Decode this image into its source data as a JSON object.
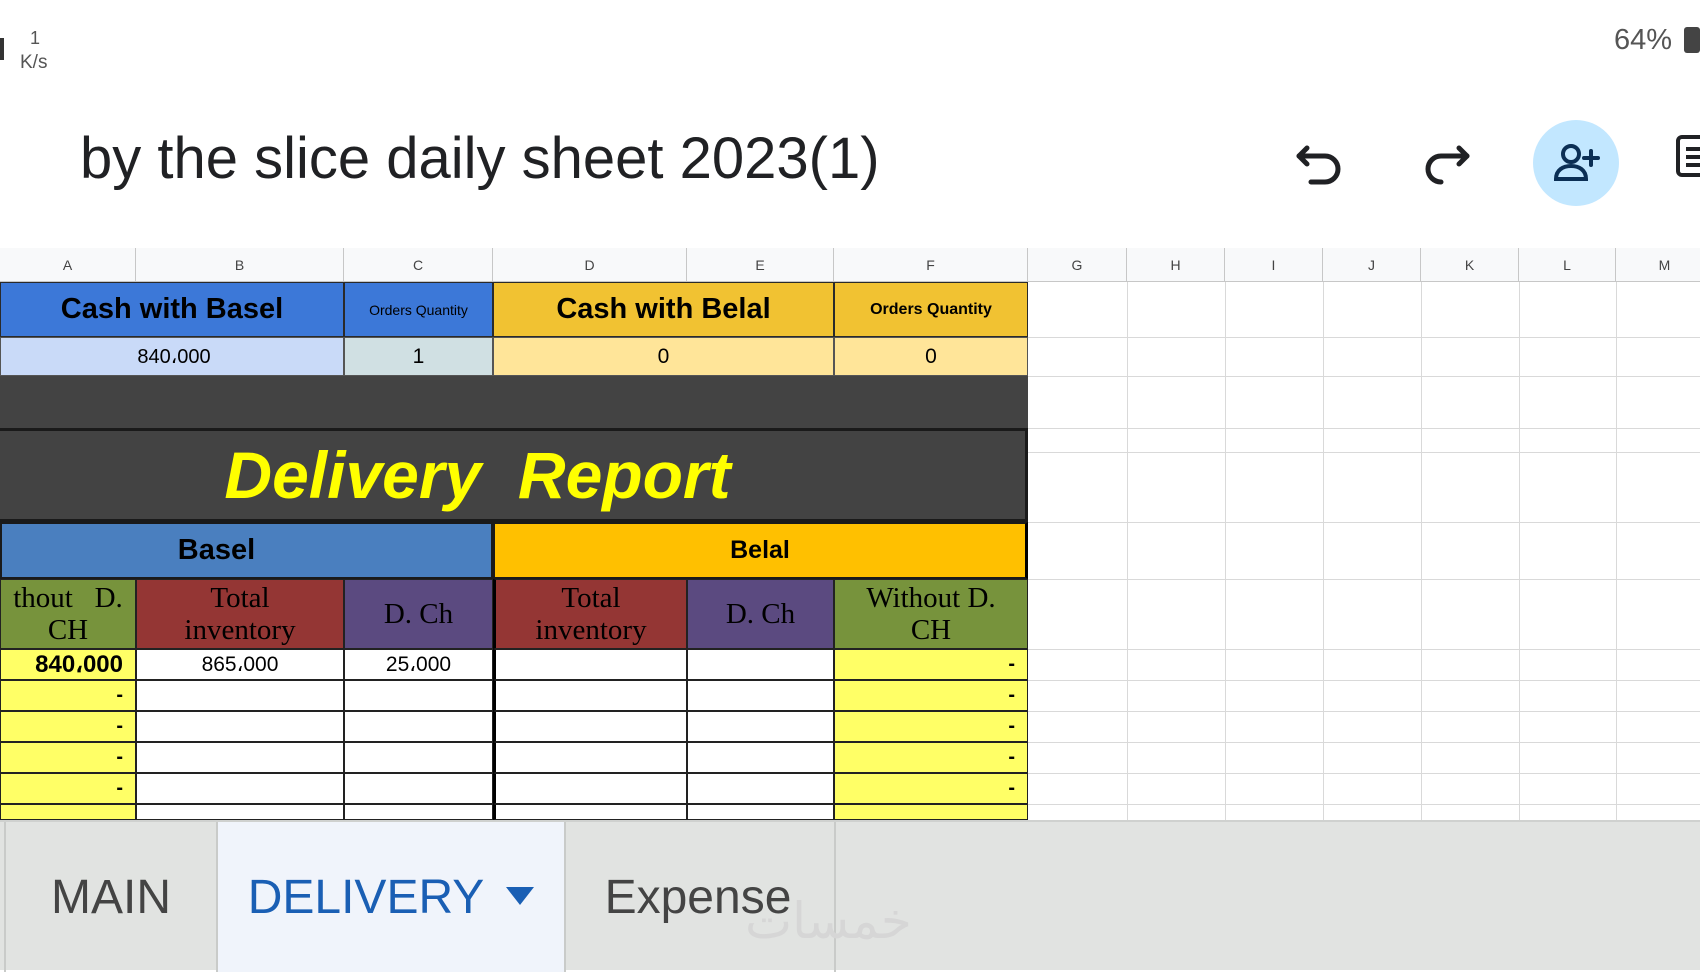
{
  "status_bar": {
    "speed_value": "1",
    "speed_unit": "K/s",
    "battery": "64%"
  },
  "document": {
    "title": "by the slice daily sheet 2023(1)"
  },
  "toolbar": {
    "undo": "undo-icon",
    "redo": "redo-icon",
    "share": "add-person-icon",
    "more": "comment-icon"
  },
  "columns": [
    "A",
    "B",
    "C",
    "D",
    "E",
    "F",
    "G",
    "H",
    "I",
    "J",
    "K",
    "L",
    "M"
  ],
  "summary": {
    "basel_label": "Cash with Basel",
    "orders_qty_label_1": "Orders Quantity",
    "belal_label": "Cash with Belal",
    "orders_qty_label_2": "Orders Quantity",
    "basel_cash": "840،000",
    "basel_orders": "1",
    "belal_cash": "0",
    "belal_orders": "0"
  },
  "report": {
    "title": "Delivery  Report",
    "basel_header": "Basel",
    "belal_header": "Belal",
    "col_without_1": "thout   D.",
    "col_without_1b": "CH",
    "col_total_1": "Total",
    "col_total_1b": "inventory",
    "col_dch_1": "D. Ch",
    "col_total_2": "Total",
    "col_total_2b": "inventory",
    "col_dch_2": "D. Ch",
    "col_without_2": "Without D.",
    "col_without_2b": "CH"
  },
  "rows": [
    {
      "a": "840،000",
      "b": "865،000",
      "c": "25،000",
      "f": "-"
    },
    {
      "a": "-",
      "b": "",
      "c": "",
      "f": "-"
    },
    {
      "a": "-",
      "b": "",
      "c": "",
      "f": "-"
    },
    {
      "a": "-",
      "b": "",
      "c": "",
      "f": "-"
    },
    {
      "a": "-",
      "b": "",
      "c": "",
      "f": "-"
    }
  ],
  "sheet_tabs": {
    "main": "MAIN",
    "delivery": "DELIVERY",
    "expense": "Expense"
  },
  "watermark": "خمسات",
  "colors": {
    "blue_header": "#3c78d8",
    "yellow_header": "#f1c232",
    "dark_band": "#434343",
    "title_yellow": "#ffff00",
    "red_col": "#943634",
    "purple_col": "#5b4a80",
    "green_col": "#77933c",
    "light_yellow": "#ffff66",
    "active_tab": "#1a5fb4"
  }
}
